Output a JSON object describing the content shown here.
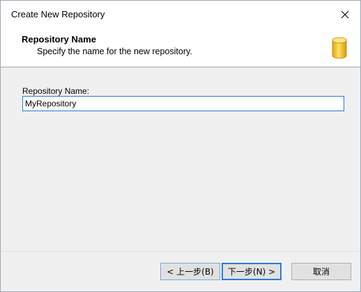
{
  "window": {
    "title": "Create New Repository"
  },
  "header": {
    "title": "Repository Name",
    "subtitle": "Specify the name for the new repository.",
    "icon": "database-icon"
  },
  "form": {
    "name_label": "Repository Name:",
    "name_value": "MyRepository"
  },
  "buttons": {
    "back_label": "< 上一步(B)",
    "next_label": "下一步(N) >",
    "cancel_label": "取消"
  },
  "colors": {
    "accent": "#2b7ad8",
    "dialog_bg": "#f0f0f0",
    "header_bg": "#ffffff",
    "database_icon": "#f2c200"
  }
}
